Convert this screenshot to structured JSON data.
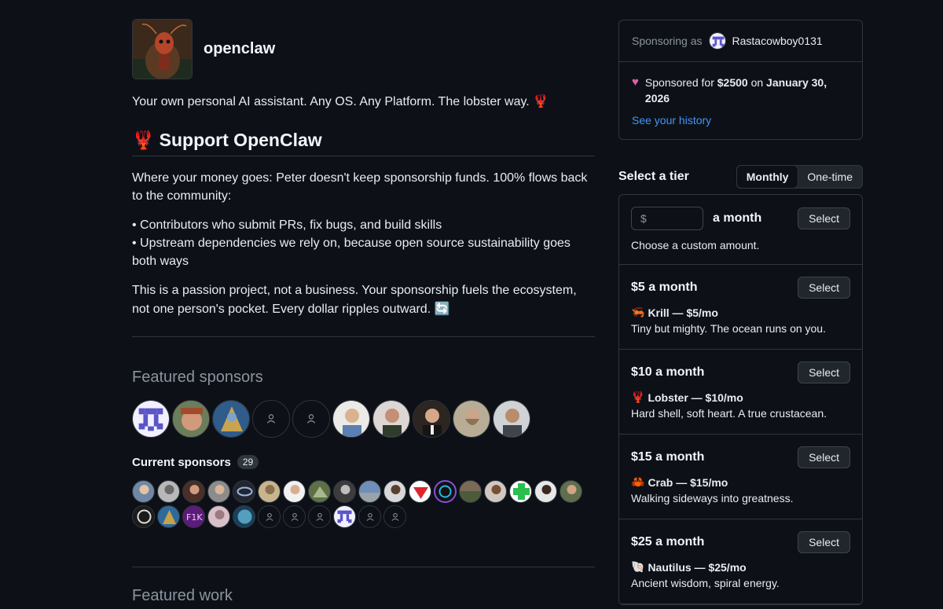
{
  "org": {
    "name": "openclaw",
    "tagline": "Your own personal AI assistant. Any OS. Any Platform. The lobster way.",
    "tagline_emoji": "🦞"
  },
  "support": {
    "heading": "Support OpenClaw",
    "heading_emoji": "🦞",
    "p1": "Where your money goes: Peter doesn't keep sponsorship funds. 100% flows back to the community:",
    "bullet1": "• Contributors who submit PRs, fix bugs, and build skills",
    "bullet2": "• Upstream dependencies we rely on, because open source sustainability goes both ways",
    "p2": "This is a passion project, not a business. Your sponsorship fuels the ecosystem, not one person's pocket. Every dollar ripples outward.",
    "p2_emoji": "🔄"
  },
  "featured_sponsors": {
    "heading": "Featured sponsors"
  },
  "current_sponsors": {
    "heading": "Current sponsors",
    "count": "29"
  },
  "featured_work": {
    "heading": "Featured work"
  },
  "sponsoring": {
    "label": "Sponsoring as",
    "username": "Rastacowboy0131",
    "sponsored_prefix": "Sponsored for",
    "amount": "$2500",
    "on": "on",
    "date": "January 30, 2026",
    "history_link": "See your history"
  },
  "tiers": {
    "heading": "Select a tier",
    "toggle_monthly": "Monthly",
    "toggle_onetime": "One-time",
    "custom": {
      "currency_placeholder": "$",
      "suffix": "a month",
      "description": "Choose a custom amount.",
      "button": "Select"
    },
    "list": [
      {
        "price": "$5 a month",
        "emoji": "🦐",
        "name": "Krill — $5/mo",
        "desc": "Tiny but mighty. The ocean runs on you.",
        "button": "Select"
      },
      {
        "price": "$10 a month",
        "emoji": "🦞",
        "name": "Lobster — $10/mo",
        "desc": "Hard shell, soft heart. A true crustacean.",
        "button": "Select"
      },
      {
        "price": "$15 a month",
        "emoji": "🦀",
        "name": "Crab — $15/mo",
        "desc": "Walking sideways into greatness.",
        "button": "Select"
      },
      {
        "price": "$25 a month",
        "emoji": "🐚",
        "name": "Nautilus — $25/mo",
        "desc": "Ancient wisdom, spiral energy.",
        "button": "Select"
      }
    ]
  },
  "colors": {
    "background": "#0d1117",
    "border": "#30363d",
    "link": "#4493f8",
    "heart": "#db61a2"
  },
  "icons": {
    "placeholder_avatar": "person-outline-icon",
    "heart": "heart-icon"
  }
}
